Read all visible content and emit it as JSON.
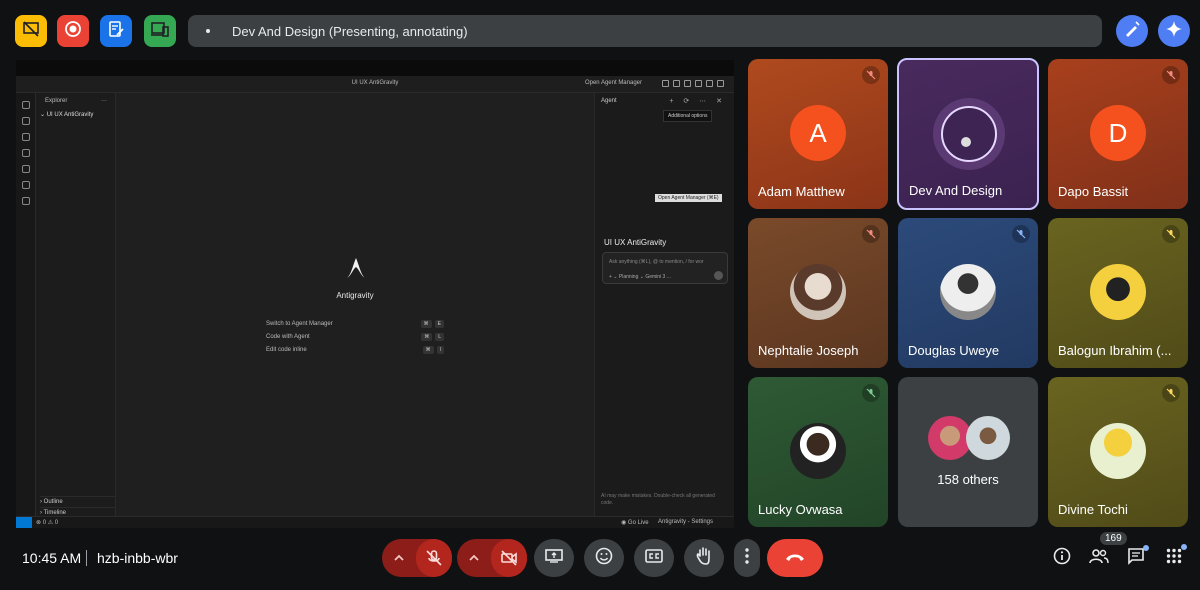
{
  "top": {
    "presenting_text": "Dev And Design (Presenting, annotating)"
  },
  "presentation": {
    "window_title": "UI UX AntiGravity",
    "open_agent_manager": "Open Agent Manager",
    "explorer_title": "Explorer",
    "explorer_more": "···",
    "folder": "UI UX AntiGravity",
    "outline": "Outline",
    "timeline": "Timeline",
    "product_name": "Antigravity",
    "commands": [
      {
        "label": "Switch to Agent Manager",
        "keys": [
          "⌘",
          "E"
        ]
      },
      {
        "label": "Code with Agent",
        "keys": [
          "⌘",
          "L"
        ]
      },
      {
        "label": "Edit code inline",
        "keys": [
          "⌘",
          "I"
        ]
      }
    ],
    "agent_title": "Agent",
    "agent_icons": "+ ⟳ ⋯ ✕",
    "tooltip_options": "Additional options",
    "tooltip_manager": "Open Agent Manager (⌘E)",
    "agent_project": "UI UX AntiGravity",
    "input_placeholder": "Ask anything (⌘L), @ to mention, / for wor",
    "input_controls": "+  ⌄ Planning   ⌄ Gemini 3 ...",
    "disclaimer": "AI may make mistakes. Double-check all generated code.",
    "status_counts": "⊗ 0 ⚠ 0",
    "status_golive": "◉ Go Live",
    "status_settings": "Antigravity - Settings"
  },
  "participants": [
    {
      "name": "Adam Matthew",
      "initial": "A",
      "muted": true
    },
    {
      "name": "Dev And Design",
      "initial": "",
      "muted": false,
      "selected": true
    },
    {
      "name": "Dapo Bassit",
      "initial": "D",
      "muted": true
    },
    {
      "name": "Nephtalie Joseph",
      "initial": "",
      "muted": true
    },
    {
      "name": "Douglas Uweye",
      "initial": "",
      "muted": true
    },
    {
      "name": "Balogun Ibrahim (...",
      "initial": "",
      "muted": true
    },
    {
      "name": "Lucky Ovwasa",
      "initial": "",
      "muted": true
    },
    {
      "name": "158 others",
      "initial": "",
      "muted": false
    },
    {
      "name": "Divine Tochi",
      "initial": "",
      "muted": true
    }
  ],
  "bottom": {
    "time": "10:45 AM",
    "meeting_code": "hzb-inbb-wbr",
    "people_count": "169"
  },
  "colors": {
    "accent_blue": "#8ab4f8",
    "end_call_red": "#ea4335",
    "muted_red": "#8c1d18"
  }
}
